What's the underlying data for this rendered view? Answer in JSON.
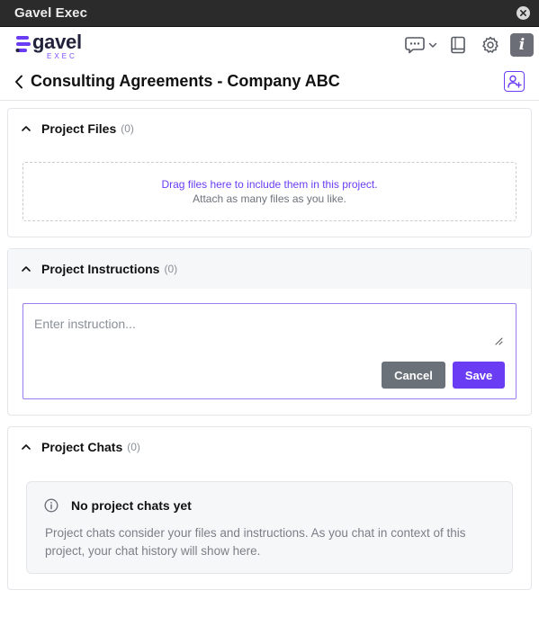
{
  "window": {
    "title": "Gavel Exec"
  },
  "brand": {
    "name": "gavel",
    "sub": "EXEC",
    "accent": "#6a3df5"
  },
  "header": {
    "icons": [
      "chat-bubble-icon",
      "chevron-down-icon",
      "book-icon",
      "gear-icon",
      "info-icon"
    ],
    "info_glyph": "i"
  },
  "page": {
    "title": "Consulting Agreements - Company ABC"
  },
  "files": {
    "title": "Project Files",
    "count": "(0)",
    "drop_primary": "Drag files here to include them in this project.",
    "drop_secondary": "Attach as many files as you like."
  },
  "instructions": {
    "title": "Project Instructions",
    "count": "(0)",
    "placeholder": "Enter instruction...",
    "value": "",
    "cancel_label": "Cancel",
    "save_label": "Save"
  },
  "chats": {
    "title": "Project Chats",
    "count": "(0)",
    "empty_title": "No project chats yet",
    "empty_body": "Project chats consider your files and instructions. As you chat in context of this project, your chat history will show here."
  },
  "colors": {
    "accent": "#6a3df5",
    "cancel": "#6b7178",
    "titlebar": "#2b2b2b",
    "panel_border": "#e3e5e8"
  }
}
